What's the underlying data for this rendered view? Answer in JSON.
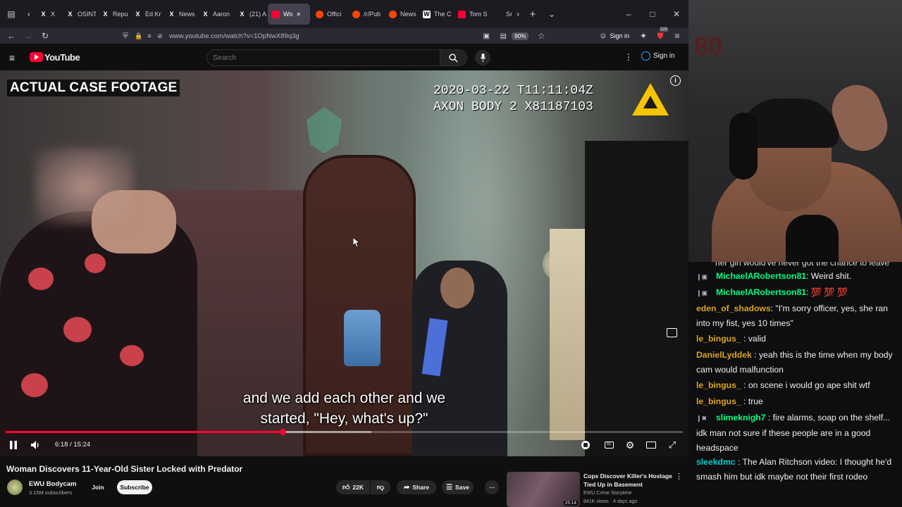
{
  "browser": {
    "tabs": [
      {
        "label": "X",
        "icon": "x-logo"
      },
      {
        "label": "OSINT",
        "icon": "x-logo"
      },
      {
        "label": "Repul",
        "icon": "x-logo"
      },
      {
        "label": "Ed Kr",
        "icon": "x-logo"
      },
      {
        "label": "News",
        "icon": "x-logo"
      },
      {
        "label": "Aaron",
        "icon": "x-logo"
      },
      {
        "label": "(21) A",
        "icon": "x-logo"
      },
      {
        "label": "Wo",
        "icon": "youtube-logo"
      },
      {
        "label": "Offici",
        "icon": "reddit-logo"
      },
      {
        "label": "/r/Pub",
        "icon": "reddit-logo"
      },
      {
        "label": "News",
        "icon": "reddit-logo"
      },
      {
        "label": "The C",
        "icon": "wikipedia-logo"
      },
      {
        "label": "Tom S",
        "icon": "youtube-logo"
      },
      {
        "label": "Sen",
        "icon": "generic"
      }
    ],
    "url": "www.youtube.com/watch?v=1OpNwX89q3g",
    "zoom": "90%",
    "signin": "Sign in",
    "notif_count": "220"
  },
  "youtube": {
    "logo_text": "YouTube",
    "search_placeholder": "Search",
    "signin": "Sign in"
  },
  "video": {
    "overlay_label": "ACTUAL CASE FOOTAGE",
    "timestamp_line1": "2020-03-22 T11:11:04Z",
    "timestamp_line2": "AXON BODY 2 X81187103",
    "caption_line1": "and we add each other and we",
    "caption_line2": "started, \"Hey, what's up?\"",
    "time": "6:18 / 15:24",
    "progress": 0.409,
    "buffered": 0.54,
    "title": "Woman Discovers 11-Year-Old Sister Locked with Predator",
    "channel": "EWU Bodycam",
    "subscribers": "3.15M subscribers",
    "join": "Join",
    "subscribe": "Subscribe",
    "likes": "22K",
    "share": "Share",
    "save": "Save"
  },
  "recommended": {
    "title": "Cops Discover Killer's Hostage Tied Up in Basement",
    "channel": "EWU Crime Storytime",
    "meta": "841K views · 4 days ago",
    "duration": "25:14"
  },
  "stream": {
    "sign_text": "80"
  },
  "chat": {
    "cut_line": "her girl would've never got the chance to leave",
    "messages": [
      {
        "user": "MichaelARobertson81",
        "color": "#00ff7f",
        "text": ": Weird shit.",
        "badges": "❙▣"
      },
      {
        "user": "MichaelARobertson81",
        "color": "#00ff7f",
        "text": ": 💯 💯 💯",
        "badges": "❙▣"
      },
      {
        "user": "eden_of_shadows",
        "color": "#daa520",
        "text": ": \"I'm sorry officer, yes, she ran into my fist, yes 10 times\"",
        "badges": ""
      },
      {
        "user": "le_bingus_",
        "color": "#daa520",
        "text": " : valid",
        "badges": ""
      },
      {
        "user": "DanielLyddek",
        "color": "#daa520",
        "text": " : yeah this is the time when my body cam would malfunction",
        "badges": ""
      },
      {
        "user": "le_bingus_",
        "color": "#daa520",
        "text": " : on scene i would go ape shit wtf",
        "badges": ""
      },
      {
        "user": "le_bingus_",
        "color": "#daa520",
        "text": " : true",
        "badges": ""
      },
      {
        "user": "slimeknigh7",
        "color": "#00ff7f",
        "text": " : fire alarms, soap on the shelf... idk man not sure if these people are in a good headspace",
        "badges": "❙✖"
      },
      {
        "user": "sleekdmc",
        "color": "#00ced1",
        "text": " : The Alan Ritchson video: I thought he'd smash him but idk maybe not their first rodeo",
        "badges": ""
      }
    ]
  },
  "colors": {
    "accent": "#ff0033",
    "link": "#3ea6ff"
  }
}
